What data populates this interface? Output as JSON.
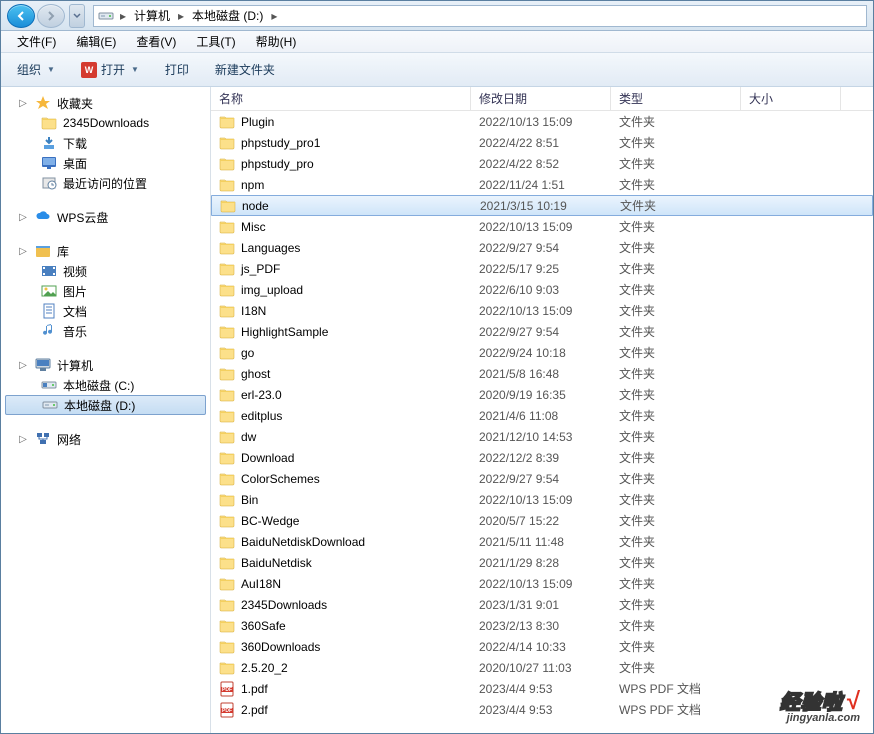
{
  "breadcrumb": {
    "root": "计算机",
    "drive": "本地磁盘 (D:)"
  },
  "menubar": {
    "file": "文件(F)",
    "edit": "编辑(E)",
    "view": "查看(V)",
    "tools": "工具(T)",
    "help": "帮助(H)"
  },
  "toolbar": {
    "organize": "组织",
    "open": "打开",
    "print": "打印",
    "new_folder": "新建文件夹"
  },
  "sidebar": {
    "favorites": {
      "label": "收藏夹",
      "items": [
        {
          "name": "2345Downloads",
          "icon": "folder"
        },
        {
          "name": "下载",
          "icon": "downloads"
        },
        {
          "name": "桌面",
          "icon": "desktop"
        },
        {
          "name": "最近访问的位置",
          "icon": "recent"
        }
      ]
    },
    "wps": {
      "label": "WPS云盘"
    },
    "libraries": {
      "label": "库",
      "items": [
        {
          "name": "视频",
          "icon": "video"
        },
        {
          "name": "图片",
          "icon": "pic"
        },
        {
          "name": "文档",
          "icon": "doc"
        },
        {
          "name": "音乐",
          "icon": "music"
        }
      ]
    },
    "computer": {
      "label": "计算机",
      "items": [
        {
          "name": "本地磁盘 (C:)",
          "icon": "drive",
          "selected": false
        },
        {
          "name": "本地磁盘 (D:)",
          "icon": "drive",
          "selected": true
        }
      ]
    },
    "network": {
      "label": "网络"
    }
  },
  "columns": {
    "name": "名称",
    "date": "修改日期",
    "type": "类型",
    "size": "大小"
  },
  "files": [
    {
      "name": "Plugin",
      "date": "2022/10/13 15:09",
      "type": "文件夹",
      "icon": "folder"
    },
    {
      "name": "phpstudy_pro1",
      "date": "2022/4/22 8:51",
      "type": "文件夹",
      "icon": "folder"
    },
    {
      "name": "phpstudy_pro",
      "date": "2022/4/22 8:52",
      "type": "文件夹",
      "icon": "folder"
    },
    {
      "name": "npm",
      "date": "2022/11/24 1:51",
      "type": "文件夹",
      "icon": "folder"
    },
    {
      "name": "node",
      "date": "2021/3/15 10:19",
      "type": "文件夹",
      "icon": "folder",
      "selected": true
    },
    {
      "name": "Misc",
      "date": "2022/10/13 15:09",
      "type": "文件夹",
      "icon": "folder"
    },
    {
      "name": "Languages",
      "date": "2022/9/27 9:54",
      "type": "文件夹",
      "icon": "folder"
    },
    {
      "name": "js_PDF",
      "date": "2022/5/17 9:25",
      "type": "文件夹",
      "icon": "folder"
    },
    {
      "name": "img_upload",
      "date": "2022/6/10 9:03",
      "type": "文件夹",
      "icon": "folder"
    },
    {
      "name": "I18N",
      "date": "2022/10/13 15:09",
      "type": "文件夹",
      "icon": "folder"
    },
    {
      "name": "HighlightSample",
      "date": "2022/9/27 9:54",
      "type": "文件夹",
      "icon": "folder"
    },
    {
      "name": "go",
      "date": "2022/9/24 10:18",
      "type": "文件夹",
      "icon": "folder"
    },
    {
      "name": "ghost",
      "date": "2021/5/8 16:48",
      "type": "文件夹",
      "icon": "folder"
    },
    {
      "name": "erl-23.0",
      "date": "2020/9/19 16:35",
      "type": "文件夹",
      "icon": "folder"
    },
    {
      "name": "editplus",
      "date": "2021/4/6 11:08",
      "type": "文件夹",
      "icon": "folder"
    },
    {
      "name": "dw",
      "date": "2021/12/10 14:53",
      "type": "文件夹",
      "icon": "folder"
    },
    {
      "name": "Download",
      "date": "2022/12/2 8:39",
      "type": "文件夹",
      "icon": "folder"
    },
    {
      "name": "ColorSchemes",
      "date": "2022/9/27 9:54",
      "type": "文件夹",
      "icon": "folder"
    },
    {
      "name": "Bin",
      "date": "2022/10/13 15:09",
      "type": "文件夹",
      "icon": "folder"
    },
    {
      "name": "BC-Wedge",
      "date": "2020/5/7 15:22",
      "type": "文件夹",
      "icon": "folder"
    },
    {
      "name": "BaiduNetdiskDownload",
      "date": "2021/5/11 11:48",
      "type": "文件夹",
      "icon": "folder"
    },
    {
      "name": "BaiduNetdisk",
      "date": "2021/1/29 8:28",
      "type": "文件夹",
      "icon": "folder"
    },
    {
      "name": "AuI18N",
      "date": "2022/10/13 15:09",
      "type": "文件夹",
      "icon": "folder"
    },
    {
      "name": "2345Downloads",
      "date": "2023/1/31 9:01",
      "type": "文件夹",
      "icon": "folder"
    },
    {
      "name": "360Safe",
      "date": "2023/2/13 8:30",
      "type": "文件夹",
      "icon": "folder"
    },
    {
      "name": "360Downloads",
      "date": "2022/4/14 10:33",
      "type": "文件夹",
      "icon": "folder"
    },
    {
      "name": "2.5.20_2",
      "date": "2020/10/27 11:03",
      "type": "文件夹",
      "icon": "folder"
    },
    {
      "name": "1.pdf",
      "date": "2023/4/4 9:53",
      "type": "WPS PDF 文档",
      "icon": "pdf"
    },
    {
      "name": "2.pdf",
      "date": "2023/4/4 9:53",
      "type": "WPS PDF 文档",
      "icon": "pdf"
    }
  ],
  "watermark": {
    "main": "经验啦",
    "sub": "jingyanla.com"
  }
}
